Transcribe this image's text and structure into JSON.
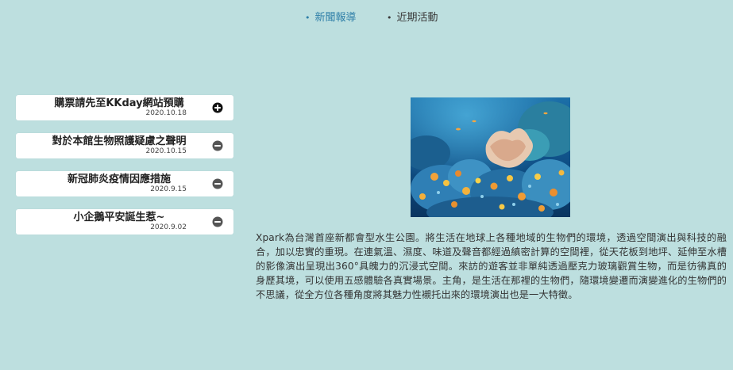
{
  "nav": {
    "tabs": [
      {
        "label": "新聞報導",
        "active": true
      },
      {
        "label": "近期活動",
        "active": false
      }
    ],
    "active_color": "#2f7fa8"
  },
  "news": [
    {
      "title": "購票請先至KKday網站預購",
      "date": "2020.10.18",
      "state": "collapsed",
      "icon": "plus-circle-icon"
    },
    {
      "title": "對於本館生物照護疑慮之聲明",
      "date": "2020.10.15",
      "state": "expanded",
      "icon": "minus-circle-icon"
    },
    {
      "title": "新冠肺炎疫情因應措施",
      "date": "2020.9.15",
      "state": "expanded",
      "icon": "minus-circle-icon"
    },
    {
      "title": "小企鵝平安誕生惹~",
      "date": "2020.9.02",
      "state": "expanded",
      "icon": "minus-circle-icon"
    }
  ],
  "article": {
    "image": "coral-reef-photo",
    "body": "Xpark為台灣首座新都會型水生公園。將生活在地球上各種地域的生物們的環境，透過空間演出與科技的融合，加以忠實的重現。在連氣溫、濕度、味道及聲音都經過縝密計算的空間裡，從天花板到地坪、延伸至水槽的影像演出呈現出360°具魄力的沉浸式空間。來訪的遊客並非單純透過壓克力玻璃觀賞生物，而是彷彿真的身歷其境，可以使用五感體驗各真實場景。主角，是生活在那裡的生物們，隨環境變遷而演變進化的生物們的不思議，從全方位各種角度將其魅力性襯托出來的環境演出也是一大特徵。"
  },
  "colors": {
    "background": "#bddfdf",
    "card": "#ffffff"
  }
}
